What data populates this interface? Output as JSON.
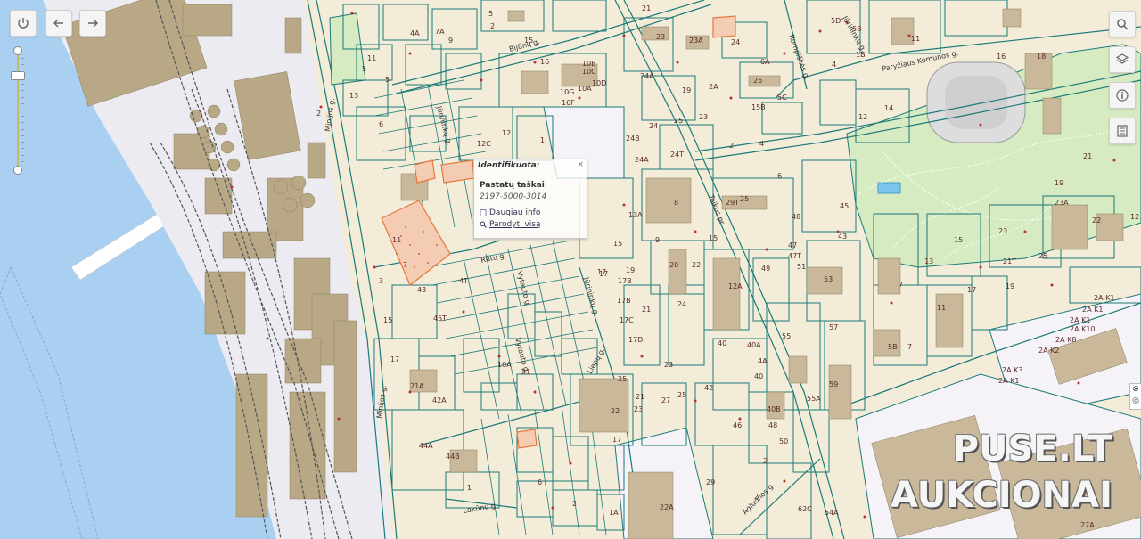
{
  "toolbar": {
    "power_icon": "power-icon",
    "back_icon": "arrow-left-icon",
    "forward_icon": "arrow-right-icon"
  },
  "right_tools": [
    "search-icon",
    "layers-icon",
    "info-icon",
    "document-list-icon"
  ],
  "zoom": {
    "level_fraction": 0.2
  },
  "popup": {
    "title": "Identifikuota:",
    "close": "×",
    "section": "Pastatų taškai",
    "id": "2197-5000-3014",
    "more_info": "Daugiau info",
    "show_all": "Parodyti visą"
  },
  "watermark": {
    "line1": "PUSE.LT",
    "line2": "AUKCIONAI"
  },
  "streets": [
    "Bijūnų g.",
    "Minijos g.",
    "Rūtų g.",
    "Lakūnų g.",
    "Liepų g.",
    "Rumpiškės g.",
    "Paryžiaus Komunos g.",
    "Taikos pr.",
    "Agluonos g.",
    "Jūrininkų g.",
    "Vytauto g."
  ],
  "parcel_numbers": [
    "5",
    "15",
    "21",
    "23",
    "23A",
    "24",
    "24A",
    "24B",
    "24T",
    "25",
    "27",
    "29",
    "40A",
    "45",
    "49",
    "51",
    "53",
    "55",
    "55A",
    "57",
    "59",
    "8",
    "10B",
    "10C",
    "10D",
    "10G",
    "10A",
    "16",
    "16F",
    "17",
    "17A",
    "17B",
    "17C",
    "17D",
    "19",
    "22",
    "22A",
    "2",
    "3",
    "4",
    "6",
    "12",
    "12C",
    "13",
    "14",
    "15T",
    "17T",
    "21T",
    "2A K1",
    "2A K2",
    "2A K3",
    "2A K8",
    "2A K10",
    "44A",
    "44B",
    "44",
    "42",
    "42A",
    "21A",
    "1",
    "45T",
    "10A",
    "1A",
    "22A",
    "54A",
    "15B",
    "5C"
  ],
  "colors": {
    "land": "#f3ecd9",
    "water": "#a9d0f1",
    "building": "#b8a886",
    "park": "#d6ebc1",
    "parcel_outline": "#1b7a78",
    "highlight": "#e8783c",
    "rail": "#666666"
  }
}
